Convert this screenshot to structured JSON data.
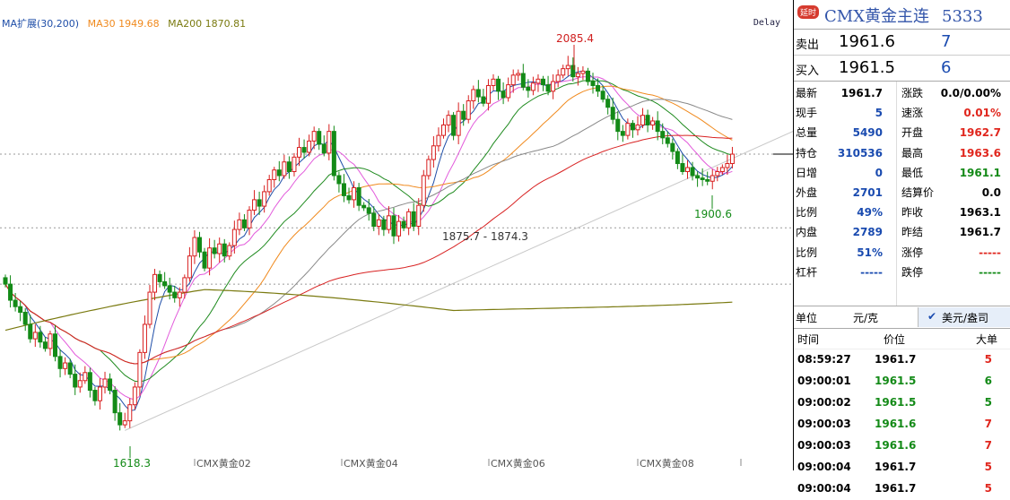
{
  "legend": {
    "items": [
      {
        "text": "MA扩展(30,200)",
        "color": "#1f4ea8"
      },
      {
        "text": "MA30 1949.68",
        "color": "#f08a1e"
      },
      {
        "text": "MA200 1870.81",
        "color": "#7a7a10"
      }
    ],
    "delay": "Delay"
  },
  "chart_data": {
    "type": "candlestick",
    "x_labels": [
      "CMX黄金02",
      "CMX黄金04",
      "CMX黄金06",
      "CMX黄金08"
    ],
    "y_range": [
      1600,
      2100
    ],
    "annotations": [
      {
        "label": "2085.4",
        "x": 113,
        "y": 2085.4,
        "color": "#d02020"
      },
      {
        "label": "1618.3",
        "x": 26,
        "y": 1618.3,
        "color": "#138a17"
      },
      {
        "label": "1900.6",
        "x": 137,
        "y": 1900.6,
        "color": "#138a17"
      },
      {
        "label": "1875.7 - 1874.3",
        "x": 86,
        "y": 1875.0,
        "color": "#333333"
      }
    ],
    "close": [
      1800,
      1780,
      1772,
      1765,
      1750,
      1732,
      1740,
      1728,
      1720,
      1738,
      1710,
      1695,
      1702,
      1688,
      1672,
      1680,
      1690,
      1668,
      1655,
      1672,
      1682,
      1668,
      1640,
      1625,
      1630,
      1650,
      1672,
      1715,
      1750,
      1790,
      1812,
      1803,
      1798,
      1790,
      1783,
      1790,
      1808,
      1835,
      1858,
      1840,
      1820,
      1845,
      1838,
      1850,
      1835,
      1848,
      1868,
      1880,
      1870,
      1892,
      1905,
      1897,
      1915,
      1930,
      1942,
      1935,
      1952,
      1940,
      1958,
      1970,
      1964,
      1978,
      1990,
      1974,
      1963,
      1990,
      1935,
      1925,
      1910,
      1905,
      1920,
      1898,
      1895,
      1888,
      1872,
      1880,
      1868,
      1885,
      1860,
      1878,
      1870,
      1890,
      1872,
      1898,
      1935,
      1955,
      1972,
      1985,
      1998,
      2010,
      1985,
      2015,
      2005,
      2028,
      2042,
      2033,
      2025,
      2047,
      2055,
      2040,
      2032,
      2048,
      2060,
      2062,
      2045,
      2041,
      2050,
      2055,
      2048,
      2040,
      2052,
      2060,
      2068,
      2072,
      2058,
      2062,
      2065,
      2052,
      2047,
      2040,
      2030,
      2020,
      2005,
      1990,
      1985,
      2000,
      1992,
      1998,
      2010,
      1998,
      2003,
      1990,
      1982,
      1975,
      1965,
      1950,
      1940,
      1945,
      1935,
      1932,
      1930,
      1928,
      1935,
      1940,
      1945,
      1950,
      1961.7
    ],
    "series": [
      {
        "name": "MA200",
        "color": "#7a7a10"
      },
      {
        "name": "MA30",
        "color": "#f08a1e"
      }
    ]
  },
  "panel": {
    "badge": "延时",
    "title": "CMX黄金主连",
    "code": "5333",
    "sell": {
      "label": "卖出",
      "price": "1961.6",
      "vol": "7"
    },
    "buy": {
      "label": "买入",
      "price": "1961.5",
      "vol": "6"
    },
    "left_rows": [
      {
        "label": "最新",
        "value": "1961.7",
        "color": "#000000"
      },
      {
        "label": "现手",
        "value": "5",
        "color": "#1a4bb0"
      },
      {
        "label": "总量",
        "value": "5490",
        "color": "#1a4bb0"
      },
      {
        "label": "持仓",
        "value": "310536",
        "color": "#1a4bb0"
      },
      {
        "label": "日增",
        "value": "0",
        "color": "#1a4bb0"
      },
      {
        "label": "外盘",
        "value": "2701",
        "color": "#1a4bb0"
      },
      {
        "label": "比例",
        "value": "49%",
        "color": "#1a4bb0"
      },
      {
        "label": "内盘",
        "value": "2789",
        "color": "#1a4bb0"
      },
      {
        "label": "比例",
        "value": "51%",
        "color": "#1a4bb0"
      },
      {
        "label": "杠杆",
        "value": "-----",
        "color": "#1a4bb0"
      }
    ],
    "right_rows": [
      {
        "label": "涨跌",
        "value": "0.0/0.00%",
        "color": "#000000"
      },
      {
        "label": "速涨",
        "value": "0.01%",
        "color": "#e0261d"
      },
      {
        "label": "开盘",
        "value": "1962.7",
        "color": "#e0261d"
      },
      {
        "label": "最高",
        "value": "1963.6",
        "color": "#e0261d"
      },
      {
        "label": "最低",
        "value": "1961.1",
        "color": "#138a17"
      },
      {
        "label": "结算价",
        "value": "0.0",
        "color": "#000000"
      },
      {
        "label": "昨收",
        "value": "1963.1",
        "color": "#000000"
      },
      {
        "label": "昨结",
        "value": "1961.7",
        "color": "#000000"
      },
      {
        "label": "涨停",
        "value": "-----",
        "color": "#e0261d"
      },
      {
        "label": "跌停",
        "value": "-----",
        "color": "#138a17"
      }
    ],
    "unit_label": "单位",
    "unit_value": "元/克",
    "currency": "美元/盎司",
    "tick_headers": {
      "time": "时间",
      "price": "价位",
      "lot": "大单"
    },
    "ticks": [
      {
        "time": "08:59:27",
        "price": "1961.7",
        "lot": "5",
        "pc": "#000000",
        "lc": "#e0261d"
      },
      {
        "time": "09:00:01",
        "price": "1961.5",
        "lot": "6",
        "pc": "#138a17",
        "lc": "#138a17"
      },
      {
        "time": "09:00:02",
        "price": "1961.5",
        "lot": "5",
        "pc": "#138a17",
        "lc": "#138a17"
      },
      {
        "time": "09:00:03",
        "price": "1961.6",
        "lot": "7",
        "pc": "#138a17",
        "lc": "#e0261d"
      },
      {
        "time": "09:00:03",
        "price": "1961.6",
        "lot": "7",
        "pc": "#138a17",
        "lc": "#e0261d"
      },
      {
        "time": "09:00:04",
        "price": "1961.7",
        "lot": "5",
        "pc": "#000000",
        "lc": "#e0261d"
      },
      {
        "time": "09:00:04",
        "price": "1961.7",
        "lot": "5",
        "pc": "#000000",
        "lc": "#e0261d"
      }
    ]
  }
}
